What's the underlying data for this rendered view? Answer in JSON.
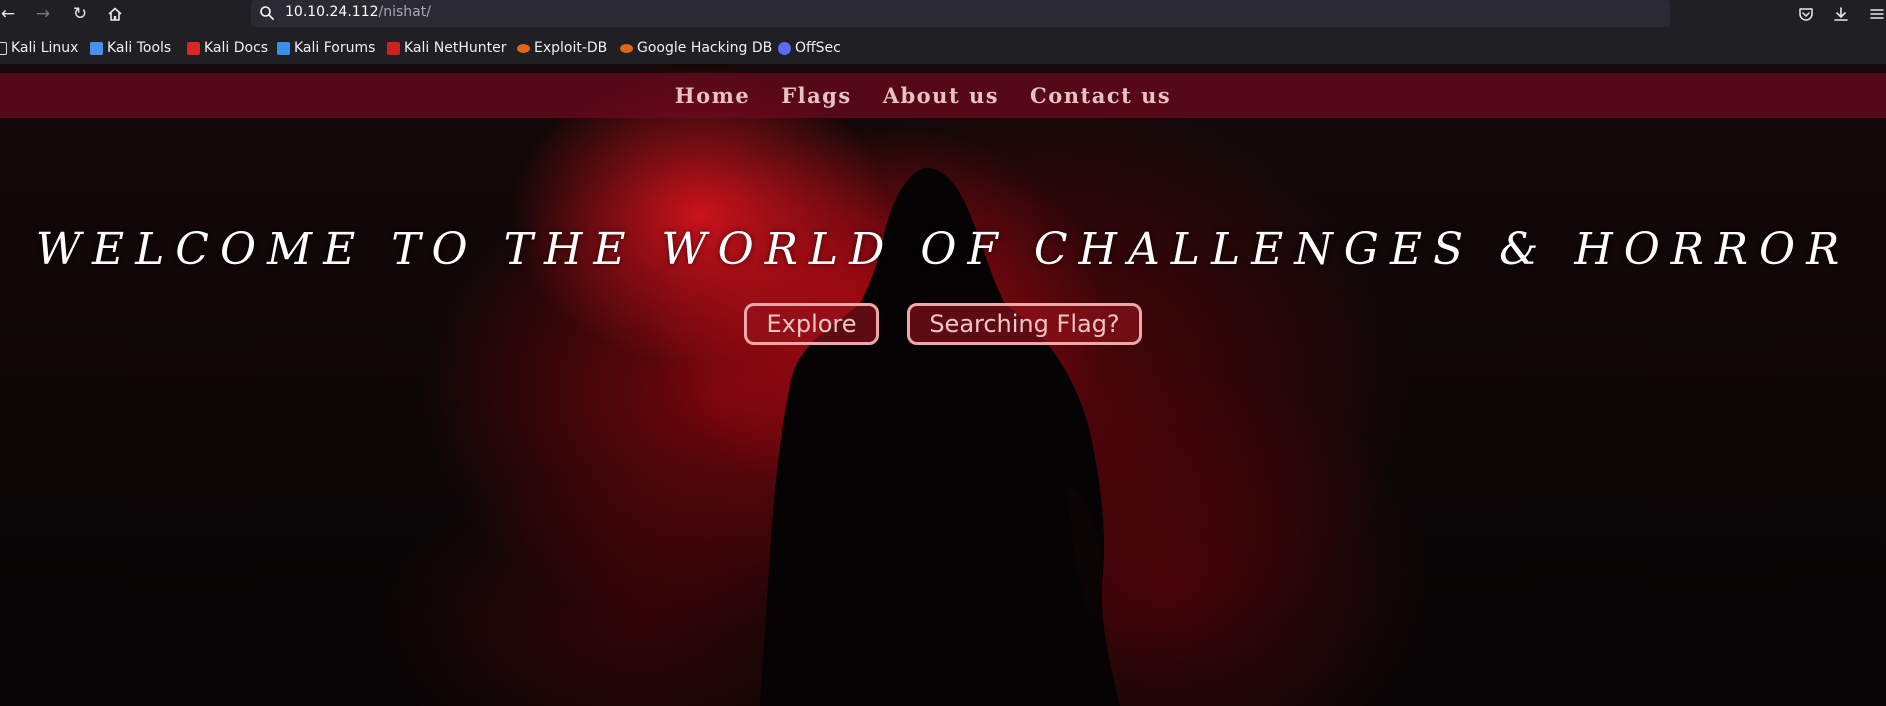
{
  "browser": {
    "url_host": "10.10.24.112",
    "url_path": "/nishat/",
    "bookmarks": [
      {
        "label": "Kali Linux",
        "color": "#ffffff"
      },
      {
        "label": "Kali Tools",
        "color": "#4a8ff0"
      },
      {
        "label": "Kali Docs",
        "color": "#e02424"
      },
      {
        "label": "Kali Forums",
        "color": "#3a8ef0"
      },
      {
        "label": "Kali NetHunter",
        "color": "#d02020"
      },
      {
        "label": "Exploit-DB",
        "color": "#e0661a"
      },
      {
        "label": "Google Hacking DB",
        "color": "#e0661a"
      },
      {
        "label": "OffSec",
        "color": "#5b6cf0"
      }
    ]
  },
  "site": {
    "nav": [
      "Home",
      "Flags",
      "About us",
      "Contact us"
    ],
    "headline": "WELCOME TO THE WORLD OF CHALLENGES & HORROR",
    "buttons": {
      "explore": "Explore",
      "flag": "Searching Flag?"
    }
  },
  "colors": {
    "nav_bar": "#6e081e",
    "button_border": "#eea8a8",
    "headline": "#ffffff"
  }
}
